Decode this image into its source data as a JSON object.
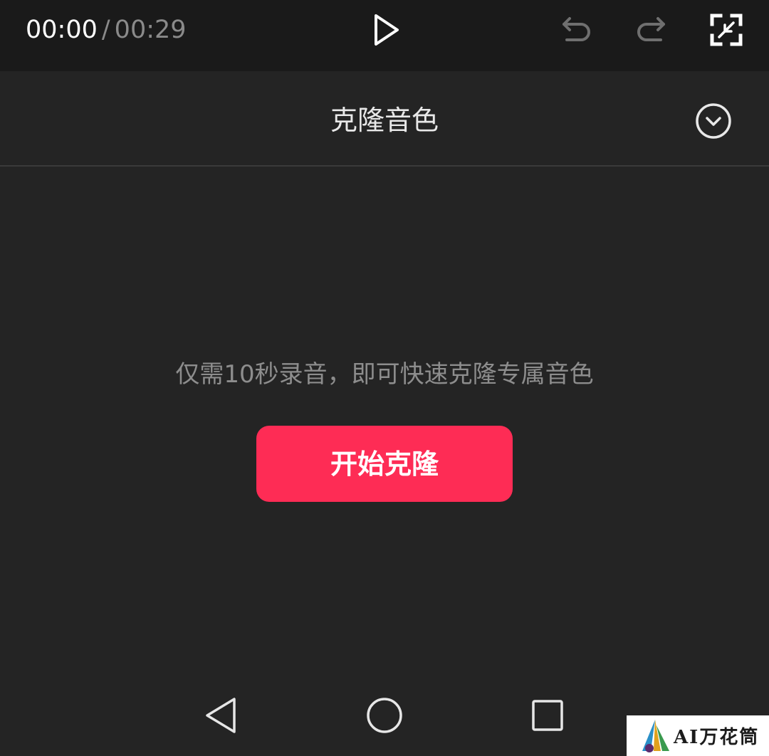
{
  "toolbar": {
    "current_time": "00:00",
    "separator": "/",
    "total_time": "00:29",
    "icons": [
      "play-icon",
      "undo-icon",
      "redo-icon",
      "fullscreen-icon"
    ]
  },
  "panel": {
    "title": "克隆音色",
    "collapse_icon": "chevron-down-circle-icon"
  },
  "main": {
    "hint": "仅需10秒录音，即可快速克隆专属音色",
    "start_button_label": "开始克隆"
  },
  "navbar": {
    "icons": [
      "back-triangle-icon",
      "home-circle-icon",
      "recent-square-icon"
    ]
  },
  "watermark": {
    "text": "AI万花筒"
  },
  "colors": {
    "background": "#242424",
    "toolbar": "#1a1a1a",
    "accent": "#fe2c55",
    "text_primary": "#e8e8e8",
    "text_muted": "#8d8d8d"
  }
}
